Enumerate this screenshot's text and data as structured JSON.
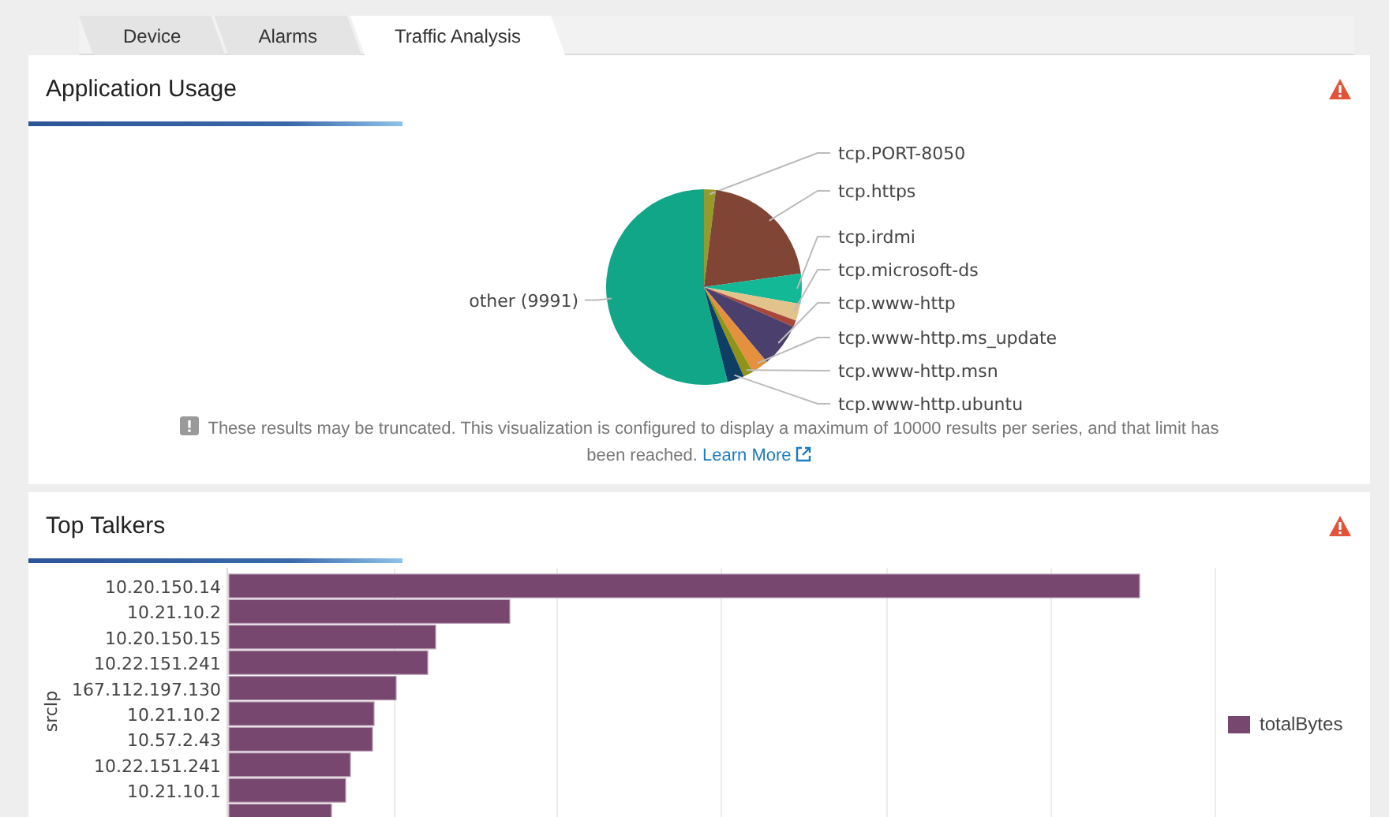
{
  "tabs": [
    {
      "label": "Device",
      "selected": false
    },
    {
      "label": "Alarms",
      "selected": false
    },
    {
      "label": "Traffic Analysis",
      "selected": true
    }
  ],
  "application_usage": {
    "title": "Application Usage",
    "slices": [
      {
        "label": "other (9991)"
      },
      {
        "label": "tcp.PORT-8050"
      },
      {
        "label": "tcp.https"
      },
      {
        "label": "tcp.irdmi"
      },
      {
        "label": "tcp.microsoft-ds"
      },
      {
        "label": "tcp.www-http"
      },
      {
        "label": "tcp.www-http.ms_update"
      },
      {
        "label": "tcp.www-http.msn"
      },
      {
        "label": "tcp.www-http.ubuntu"
      }
    ],
    "notice": {
      "text": "These results may be truncated. This visualization is configured to display a maximum of 10000 results per series, and that limit has been reached.",
      "link": "Learn More"
    }
  },
  "top_talkers": {
    "title": "Top Talkers",
    "ylabel": "srcIp",
    "legend": "totalBytes",
    "rows": [
      "10.20.150.14",
      "10.21.10.2",
      "10.20.150.15",
      "10.22.151.241",
      "167.112.197.130",
      "10.21.10.2",
      "10.57.2.43",
      "10.22.151.241",
      "10.21.10.1"
    ]
  }
}
